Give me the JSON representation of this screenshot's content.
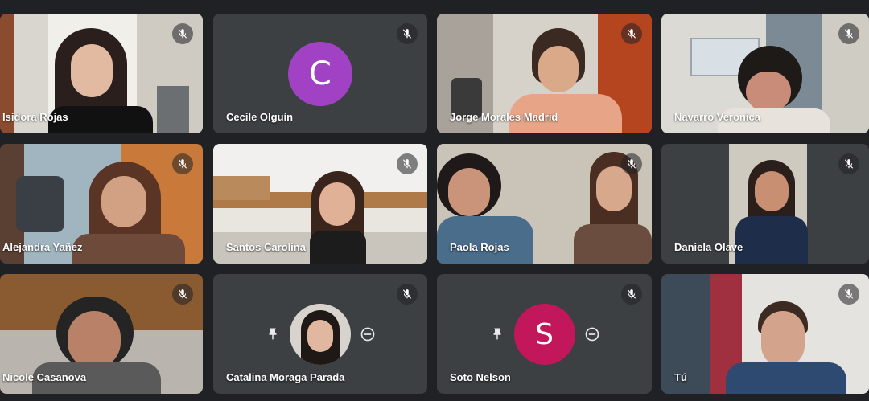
{
  "participants": [
    {
      "name": "Isidora Rojas",
      "muted": true
    },
    {
      "name": "Cecile Olguín",
      "muted": true,
      "avatar_letter": "C",
      "avatar_color": "#a142c4"
    },
    {
      "name": "Jorge Morales Madrid",
      "muted": true
    },
    {
      "name": "Navarro Veronica",
      "muted": true
    },
    {
      "name": "Alejandra Yañez",
      "muted": true
    },
    {
      "name": "Santos Carolina",
      "muted": true
    },
    {
      "name": "Paola Rojas",
      "muted": true
    },
    {
      "name": "Daniela Olave",
      "muted": true
    },
    {
      "name": "Nicole Casanova",
      "muted": true
    },
    {
      "name": "Catalina Moraga Parada",
      "muted": true
    },
    {
      "name": "Soto Nelson",
      "muted": true,
      "avatar_letter": "S",
      "avatar_color": "#c2185b"
    },
    {
      "name": "Tú",
      "muted": true
    }
  ],
  "icons": {
    "mute": "mic-off-icon",
    "pin": "pin-icon",
    "remove": "remove-icon"
  },
  "colors": {
    "background": "#202124",
    "tile": "#3c4043"
  }
}
